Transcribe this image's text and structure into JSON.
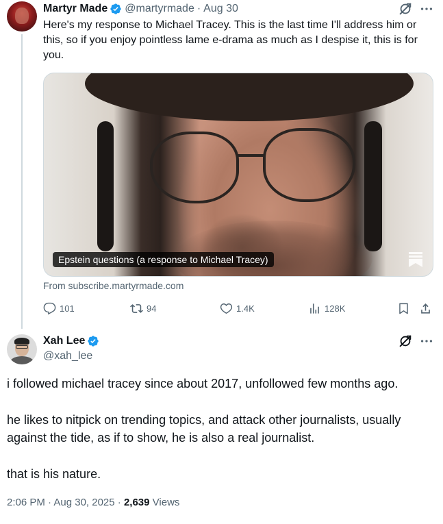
{
  "parent_tweet": {
    "author_name": "Martyr Made",
    "handle": "@martyrmade",
    "separator": "·",
    "date": "Aug 30",
    "text": "Here's my response to Michael Tracey. This is the last time I'll address him or this, so if you enjoy pointless lame e-drama as much as I despise it, this is for you.",
    "media_caption": "Epstein questions (a response to Michael Tracey)",
    "link_source": "From subscribe.martyrmade.com",
    "stats": {
      "replies": "101",
      "reposts": "94",
      "likes": "1.4K",
      "views": "128K"
    }
  },
  "main_tweet": {
    "author_name": "Xah Lee",
    "handle": "@xah_lee",
    "paragraphs": [
      "i followed michael tracey since about 2017, unfollowed few months ago.",
      "he likes to nitpick on trending topics, and attack other journalists, usually against the tide, as if to show, he is also a real journalist.",
      "that is his nature."
    ],
    "timestamp": "2:06 PM · Aug 30, 2025 · ",
    "views_count": "2,639",
    "views_label": " Views"
  },
  "colors": {
    "text_primary": "#0f1419",
    "text_secondary": "#536471",
    "verified_blue": "#1d9bf0",
    "thread_line": "#cfd9de"
  },
  "icons": [
    "verified-badge-icon",
    "grok-icon",
    "more-icon",
    "reply-icon",
    "repost-icon",
    "like-icon",
    "views-icon",
    "bookmark-icon",
    "share-icon"
  ]
}
